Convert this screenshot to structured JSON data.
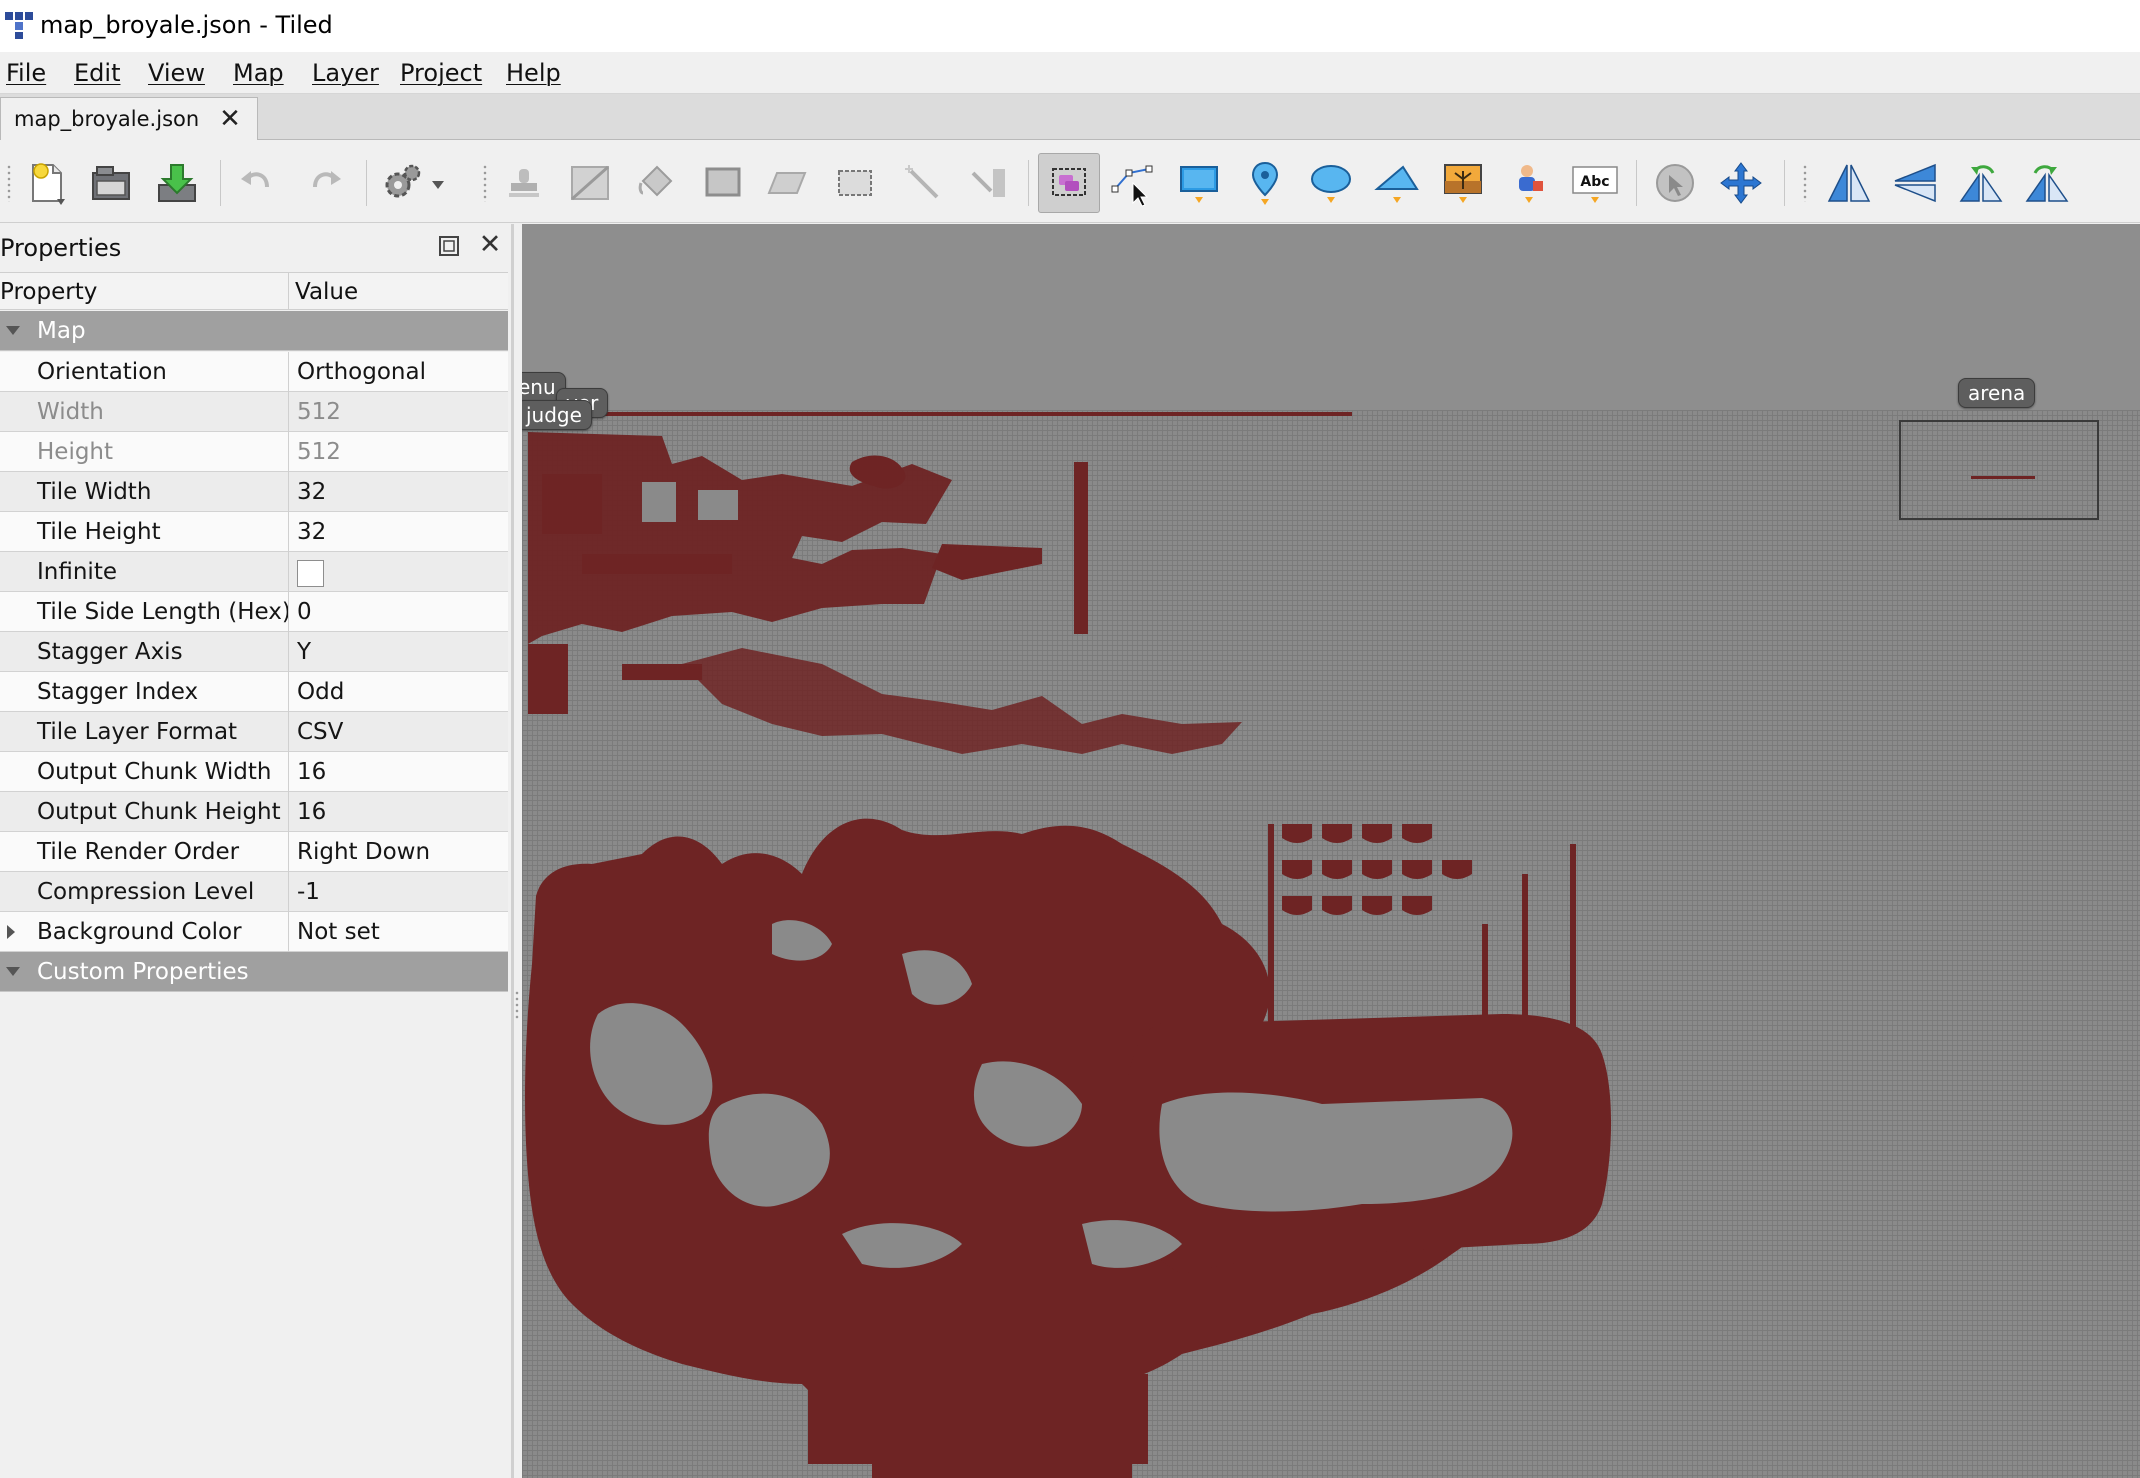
{
  "window": {
    "title": "map_broyale.json - Tiled"
  },
  "menu": {
    "file": "File",
    "edit": "Edit",
    "view": "View",
    "map": "Map",
    "layer": "Layer",
    "project": "Project",
    "help": "Help"
  },
  "tabs": [
    {
      "label": "map_broyale.json",
      "close": "✕"
    }
  ],
  "properties_panel": {
    "title": "Properties",
    "close": "✕",
    "columns": {
      "property": "Property",
      "value": "Value"
    },
    "groups": {
      "map": "Map",
      "custom": "Custom Properties"
    },
    "rows": [
      {
        "name": "Orientation",
        "value": "Orthogonal"
      },
      {
        "name": "Width",
        "value": "512"
      },
      {
        "name": "Height",
        "value": "512"
      },
      {
        "name": "Tile Width",
        "value": "32"
      },
      {
        "name": "Tile Height",
        "value": "32"
      },
      {
        "name": "Infinite",
        "value": ""
      },
      {
        "name": "Tile Side Length (Hex)",
        "value": "0"
      },
      {
        "name": "Stagger Axis",
        "value": "Y"
      },
      {
        "name": "Stagger Index",
        "value": "Odd"
      },
      {
        "name": "Tile Layer Format",
        "value": "CSV"
      },
      {
        "name": "Output Chunk Width",
        "value": "16"
      },
      {
        "name": "Output Chunk Height",
        "value": "16"
      },
      {
        "name": "Tile Render Order",
        "value": "Right Down"
      },
      {
        "name": "Compression Level",
        "value": "-1"
      },
      {
        "name": "Background Color",
        "value": "Not set"
      }
    ]
  },
  "toolbar": {
    "text_tool_label": "Abc",
    "icons": [
      "new-map-icon",
      "open-icon",
      "save-icon",
      "undo-icon",
      "redo-icon",
      "commands-icon",
      "stamp-brush-icon",
      "terrain-brush-icon",
      "bucket-fill-icon",
      "shape-fill-icon",
      "eraser-icon",
      "rect-select-icon",
      "magic-wand-icon",
      "select-same-tile-icon",
      "select-objects-icon",
      "edit-polygons-icon",
      "insert-rectangle-icon",
      "insert-point-icon",
      "insert-ellipse-icon",
      "insert-polygon-icon",
      "insert-tile-icon",
      "insert-template-icon",
      "insert-text-icon",
      "world-tool-icon",
      "move-icon",
      "flip-horizontal-icon",
      "flip-vertical-icon",
      "rotate-left-icon",
      "rotate-right-icon"
    ]
  },
  "canvas": {
    "object_labels": {
      "menu": "enu",
      "player": "yer",
      "judge": "judge",
      "arena": "arena"
    },
    "colors": {
      "map_tiles": "#6e2424",
      "background": "#8a8a8a"
    }
  }
}
